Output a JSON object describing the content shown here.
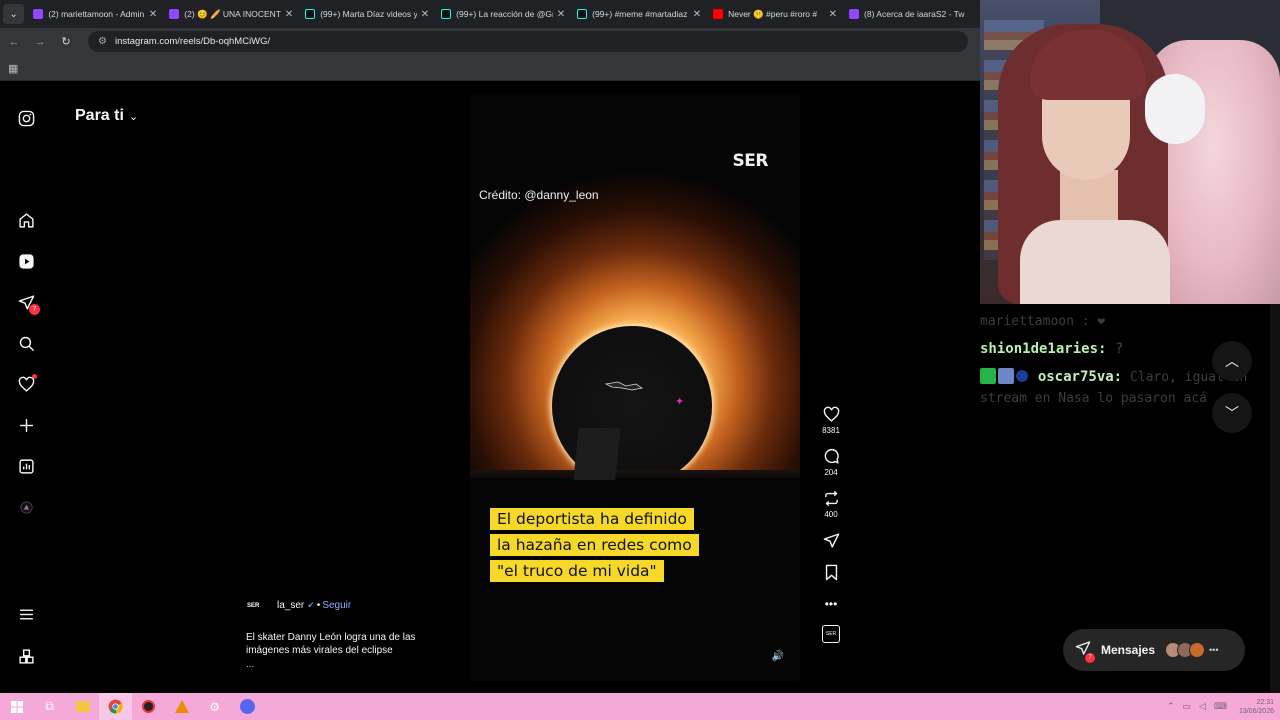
{
  "browser": {
    "tabs": [
      {
        "title": "(2) mariettamoon - Admin",
        "favicon_color": "#9146ff"
      },
      {
        "title": "(2) 😊 🥖 UNA INOCENTE",
        "favicon_color": "#9146ff"
      },
      {
        "title": "(99+) Marta Díaz videos y",
        "favicon_color": "#000000"
      },
      {
        "title": "(99+) La reacción de @Gr",
        "favicon_color": "#000000"
      },
      {
        "title": "(99+) #meme #martadiaz",
        "favicon_color": "#000000"
      },
      {
        "title": "Never 🤫 #peru #roro #",
        "favicon_color": "#ff0000"
      },
      {
        "title": "(8) Acerca de iaaraS2 - Tw",
        "favicon_color": "#9146ff"
      }
    ],
    "url": "instagram.com/reels/Db-oqhMCiWG/"
  },
  "instagram": {
    "feed_title": "Para ti",
    "notifications_badge": "7",
    "reel": {
      "brand": "SER",
      "credit": "Crédito: @danny_leon",
      "caption_lines": [
        "El deportista ha definido",
        "la hazaña en redes como",
        "\"el truco de mi vida\""
      ],
      "caption_color": "#f6d928"
    },
    "actions": {
      "likes": "8381",
      "comments": "204",
      "reposts": "400"
    },
    "author": {
      "avatar_text": "SER",
      "name": "la_ser",
      "separator": "•",
      "follow": "Seguir"
    },
    "description": "El skater Danny León logra una de las imágenes más virales del eclipse",
    "more": "...",
    "messages": {
      "label": "Mensajes",
      "badge": "7"
    }
  },
  "stream": {
    "chat": [
      {
        "user": "mariettamoon",
        "text": ": ❤"
      },
      {
        "user": "shion1de1aries:",
        "text": "?"
      },
      {
        "user": "oscar75va:",
        "text": "Claro, igual en stream en Nasa lo pasaron acá"
      }
    ]
  },
  "taskbar": {
    "time": "22:31",
    "date": "13/06/2026"
  }
}
